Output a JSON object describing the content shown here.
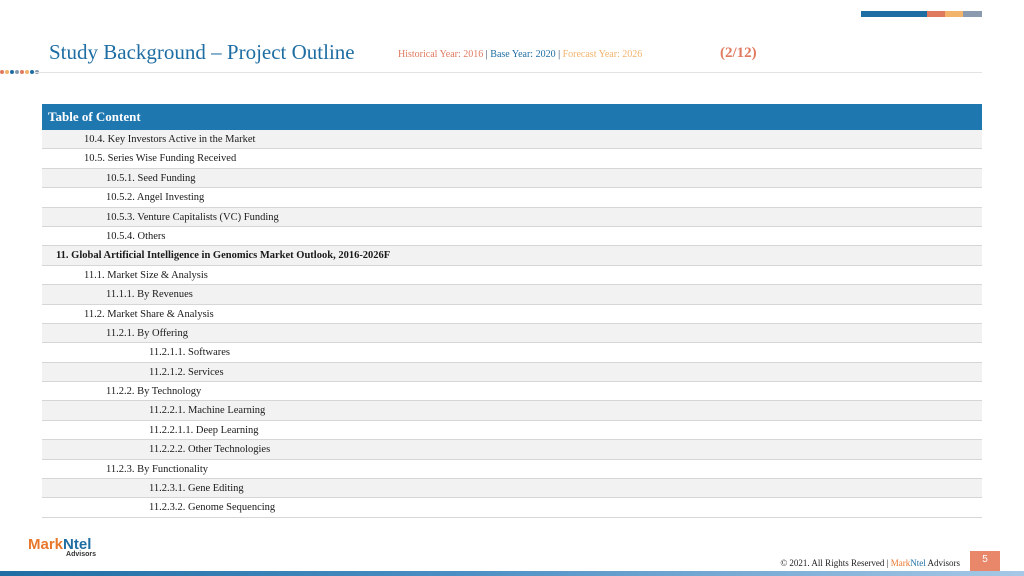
{
  "header": {
    "title": "Study Background – Project Outline",
    "historical": "Historical Year: 2016",
    "separator": "|",
    "base": "Base Year: 2020",
    "forecast": "Forecast Year: 2026",
    "page_count": "(2/12)"
  },
  "toc": {
    "heading": "Table of Content",
    "rows": [
      {
        "text": "10.4.   Key Investors Active in the Market",
        "level": 1,
        "bold": false
      },
      {
        "text": "10.5.   Series Wise Funding Received",
        "level": 1,
        "bold": false
      },
      {
        "text": "10.5.1.   Seed Funding",
        "level": 2,
        "bold": false
      },
      {
        "text": "10.5.2.   Angel Investing",
        "level": 2,
        "bold": false
      },
      {
        "text": "10.5.3.   Venture Capitalists (VC) Funding",
        "level": 2,
        "bold": false
      },
      {
        "text": "10.5.4.   Others",
        "level": 2,
        "bold": false
      },
      {
        "text": "11.  Global Artificial Intelligence in Genomics Market Outlook, 2016-2026F",
        "level": 0,
        "bold": true
      },
      {
        "text": "11.1.  Market Size & Analysis",
        "level": 1,
        "bold": false
      },
      {
        "text": "11.1.1.   By Revenues",
        "level": 2,
        "bold": false
      },
      {
        "text": "11.2.  Market Share & Analysis",
        "level": 1,
        "bold": false
      },
      {
        "text": "11.2.1.   By Offering",
        "level": 2,
        "bold": false
      },
      {
        "text": "11.2.1.1.  Softwares",
        "level": 3,
        "bold": false
      },
      {
        "text": "11.2.1.2.  Services",
        "level": 3,
        "bold": false
      },
      {
        "text": "11.2.2.   By Technology",
        "level": 2,
        "bold": false
      },
      {
        "text": "11.2.2.1.  Machine Learning",
        "level": 3,
        "bold": false
      },
      {
        "text": "11.2.2.1.1.  Deep Learning",
        "level": 3,
        "bold": false
      },
      {
        "text": "11.2.2.2.  Other Technologies",
        "level": 3,
        "bold": false
      },
      {
        "text": "11.2.3.   By Functionality",
        "level": 2,
        "bold": false
      },
      {
        "text": "11.2.3.1.  Gene Editing",
        "level": 3,
        "bold": false
      },
      {
        "text": "11.2.3.2.  Genome Sequencing",
        "level": 3,
        "bold": false
      }
    ]
  },
  "logo": {
    "mark": "Mark",
    "ntel": "Ntel",
    "sub": "Advisors"
  },
  "footer": {
    "copyright": "© 2021. All Rights Reserved | ",
    "mark": "Mark",
    "ntel": "Ntel",
    "advisors": " Advisors",
    "page_number": "5"
  },
  "colors": {
    "primary_blue": "#1f6ea3",
    "table_header": "#1f77b0",
    "accent_orange": "#e07a5f",
    "accent_yellow": "#f2b36b",
    "logo_orange": "#e8772e"
  }
}
